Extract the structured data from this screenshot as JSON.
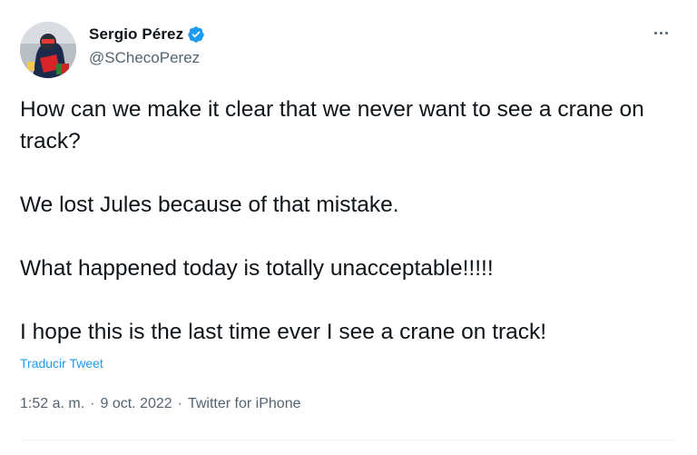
{
  "user": {
    "display_name": "Sergio Pérez",
    "handle": "@SChecoPerez",
    "verified": true
  },
  "tweet": {
    "paragraphs": [
      "How can we make it clear that we never want to see a crane on track?",
      "We lost Jules because of that mistake.",
      "What happened today is totally unacceptable!!!!!",
      "I hope this is the last time ever I see a crane on track!"
    ],
    "translate_label": "Traducir Tweet",
    "time": "1:52 a. m.",
    "separator": "·",
    "date": "9 oct. 2022",
    "source": "Twitter for iPhone"
  },
  "icons": {
    "verified": "verified-badge-icon",
    "more": "more-options-icon"
  },
  "colors": {
    "text": "#0f1419",
    "secondary": "#536471",
    "link": "#1d9bf0",
    "verified": "#1d9bf0"
  }
}
